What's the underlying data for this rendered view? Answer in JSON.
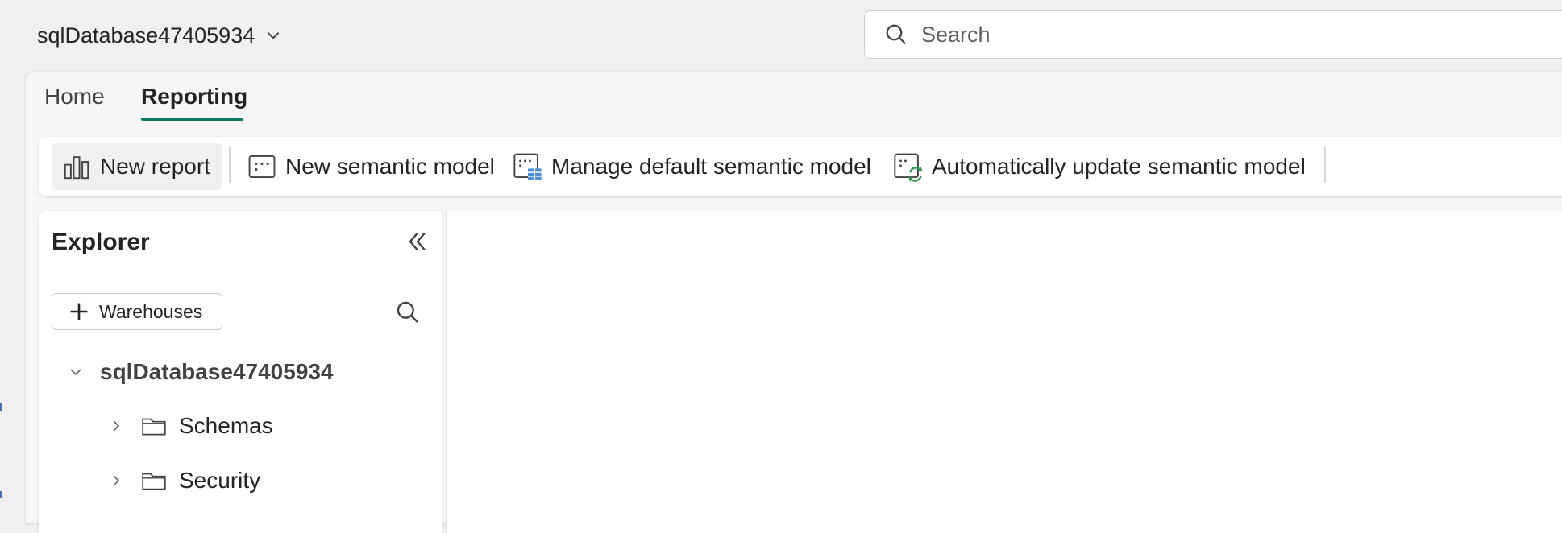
{
  "topbar": {
    "database_name": "sqlDatabase47405934",
    "search_placeholder": "Search"
  },
  "tabs": [
    {
      "label": "Home",
      "active": false
    },
    {
      "label": "Reporting",
      "active": true
    }
  ],
  "ribbon": {
    "new_report": "New report",
    "new_semantic_model": "New semantic model",
    "manage_default_semantic_model": "Manage default semantic model",
    "auto_update_semantic_model": "Automatically update semantic model"
  },
  "explorer": {
    "title": "Explorer",
    "add_button_label": "Warehouses",
    "tree": {
      "root": "sqlDatabase47405934",
      "children": [
        "Schemas",
        "Security"
      ]
    }
  },
  "colors": {
    "accent": "#117865",
    "background": "#f0eff1"
  },
  "icons": {
    "db_dropdown": "chevron-down-icon",
    "search": "search-icon",
    "new_report": "bar-chart-icon",
    "new_semantic_model": "semantic-model-icon",
    "manage_semantic_model": "manage-semantic-model-icon",
    "auto_update": "auto-update-icon",
    "collapse": "double-chevron-left-icon",
    "add": "plus-icon",
    "folder": "folder-icon"
  }
}
